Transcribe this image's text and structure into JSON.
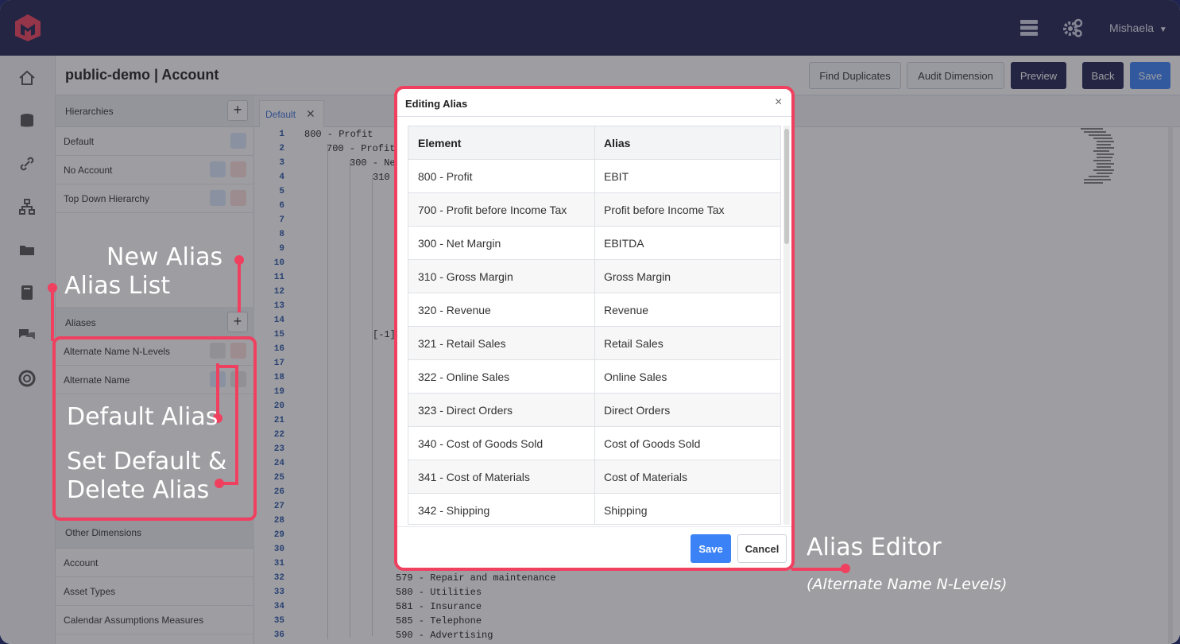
{
  "navbar": {
    "user": "Mishaela"
  },
  "header": {
    "title": "public-demo | Account",
    "buttons": {
      "find_duplicates": "Find Duplicates",
      "audit_dimension": "Audit Dimension",
      "preview": "Preview",
      "back": "Back",
      "save": "Save"
    }
  },
  "left_panel": {
    "hierarchies_label": "Hierarchies",
    "hierarchies": [
      "Default",
      "No Account",
      "Top Down Hierarchy"
    ],
    "aliases_label": "Aliases",
    "aliases": [
      "Alternate Name N-Levels",
      "Alternate Name"
    ],
    "other_label": "Other Dimensions",
    "other_dimensions": [
      "Account",
      "Asset Types",
      "Calendar Assumptions Measures"
    ]
  },
  "editor": {
    "tab": "Default",
    "line_numbers": [
      "1",
      "2",
      "3",
      "4",
      "5",
      "6",
      "7",
      "8",
      "9",
      "10",
      "11",
      "12",
      "13",
      "14",
      "15",
      "16",
      "17",
      "18",
      "19",
      "20",
      "21",
      "22",
      "23",
      "24",
      "25",
      "26",
      "27",
      "28",
      "29",
      "30",
      "31",
      "32",
      "33",
      "34",
      "35",
      "36"
    ],
    "code_lines": {
      "l1": "800 - Profit",
      "l2": "700 - Profit",
      "l3": "300 - Ne",
      "l4": "310",
      "l15": "[-1]",
      "l32": "579 - Repair and maintenance",
      "l33": "580 - Utilities",
      "l34": "581 - Insurance",
      "l35": "585 - Telephone",
      "l36": "590 - Advertising"
    }
  },
  "modal": {
    "title": "Editing Alias",
    "close": "×",
    "columns": [
      "Element",
      "Alias"
    ],
    "rows": [
      {
        "element": "800 - Profit",
        "alias": "EBIT"
      },
      {
        "element": "700 - Profit before Income Tax",
        "alias": "Profit before Income Tax"
      },
      {
        "element": "300 - Net Margin",
        "alias": "EBITDA"
      },
      {
        "element": "310 - Gross Margin",
        "alias": "Gross Margin"
      },
      {
        "element": "320 - Revenue",
        "alias": "Revenue"
      },
      {
        "element": "321 - Retail Sales",
        "alias": "Retail Sales"
      },
      {
        "element": "322 - Online Sales",
        "alias": "Online Sales"
      },
      {
        "element": "323 - Direct Orders",
        "alias": "Direct Orders"
      },
      {
        "element": "340 - Cost of Goods Sold",
        "alias": "Cost of Goods Sold"
      },
      {
        "element": "341 - Cost of Materials",
        "alias": "Cost of Materials"
      },
      {
        "element": "342 - Shipping",
        "alias": "Shipping"
      }
    ],
    "save": "Save",
    "cancel": "Cancel"
  },
  "annotations": {
    "new_alias": "New Alias",
    "alias_list": "Alias List",
    "default_alias": "Default Alias",
    "set_default_line1": "Set Default &",
    "set_default_line2": "Delete Alias",
    "alias_editor": "Alias Editor",
    "alias_editor_sub": "(Alternate Name N-Levels)"
  },
  "colors": {
    "navbar": "#1f2452",
    "primary": "#3b82f6",
    "annotation": "#ef4060"
  }
}
